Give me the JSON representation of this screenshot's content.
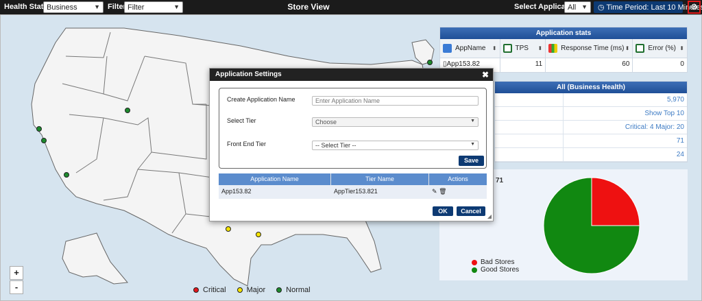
{
  "header": {
    "health_status_label": "Health Status",
    "health_status_value": "Business",
    "filter_label": "Filter",
    "filter_value": "Filter",
    "title": "Store View",
    "select_application_label": "Select Application",
    "select_application_value": "All",
    "time_period": "Time Period: Last 10 Minutes",
    "settings_icon": "gear-icon"
  },
  "map": {
    "zoom_in": "+",
    "zoom_out": "-",
    "legend": [
      {
        "label": "Critical",
        "color": "#e3161c"
      },
      {
        "label": "Major",
        "color": "#f5e400"
      },
      {
        "label": "Normal",
        "color": "#1d8a2d"
      }
    ],
    "store_status_colors": [
      "#1d8a2d",
      "#1d8a2d",
      "#1d8a2d",
      "#1d8a2d",
      "#1d8a2d",
      "#f5e400",
      "#f5e400"
    ]
  },
  "app_stats": {
    "title": "Application stats",
    "columns": [
      {
        "label": "AppName",
        "icon": "app-icon"
      },
      {
        "label": "TPS",
        "icon": "tps-icon"
      },
      {
        "label": "Response Time (ms)",
        "icon": "bar-chart-icon"
      },
      {
        "label": "Error (%)",
        "icon": "error-icon"
      }
    ],
    "row": {
      "app_name": "App153.82",
      "tps": "11",
      "response_time": "60",
      "error": "0"
    }
  },
  "business_health": {
    "title": "All (Business Health)",
    "values": [
      "5,970",
      "Show Top 10",
      "Critical: 4 Major: 20",
      "71",
      "24"
    ]
  },
  "store_chart": {
    "title_fragment": "71",
    "legend": [
      {
        "label": "Bad Stores",
        "color": "#ee1111"
      },
      {
        "label": "Good Stores",
        "color": "#118811"
      }
    ]
  },
  "chart_data": {
    "type": "pie",
    "title": "",
    "categories": [
      "Bad Stores",
      "Good Stores"
    ],
    "values": [
      25,
      75
    ],
    "colors": [
      "#ee1111",
      "#118811"
    ]
  },
  "modal": {
    "title": "Application Settings",
    "close": "✖",
    "create_app_label": "Create Application Name",
    "create_app_placeholder": "Enter Application Name",
    "select_tier_label": "Select Tier",
    "select_tier_value": "Choose",
    "front_end_tier_label": "Front End Tier",
    "front_end_tier_value": "-- Select Tier --",
    "save_label": "Save",
    "table_headers": [
      "Application Name",
      "Tier Name",
      "Actions"
    ],
    "table_row": {
      "application_name": "App153.82",
      "tier_name": "AppTier153.821"
    },
    "ok_label": "OK",
    "cancel_label": "Cancel"
  }
}
